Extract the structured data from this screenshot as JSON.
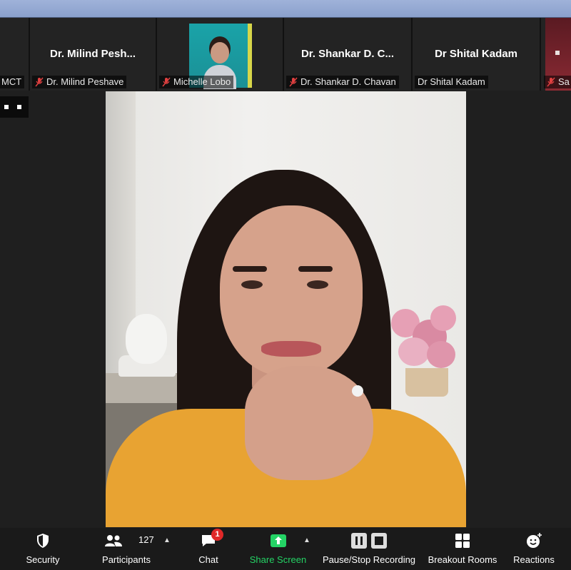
{
  "participants_strip": [
    {
      "display": "",
      "name": "MCT",
      "muted": false
    },
    {
      "display": "Dr. Milind Pesh...",
      "name": "Dr. Milind Peshave",
      "muted": true
    },
    {
      "display": "",
      "name": "Michelle Lobo",
      "muted": true,
      "has_video": true
    },
    {
      "display": "Dr. Shankar D. C...",
      "name": "Dr. Shankar D. Chavan",
      "muted": true
    },
    {
      "display": "Dr Shital Kadam",
      "name": "Dr Shital Kadam",
      "muted": false
    },
    {
      "display": "",
      "name": "Sa",
      "muted": true,
      "has_video": true
    }
  ],
  "toolbar": {
    "security": "Security",
    "participants": "Participants",
    "participants_count": "127",
    "chat": "Chat",
    "chat_badge": "1",
    "share_screen": "Share Screen",
    "recording": "Pause/Stop Recording",
    "breakout": "Breakout Rooms",
    "reactions": "Reactions"
  },
  "colors": {
    "share_screen_green": "#24d365",
    "chat_badge_red": "#e02828",
    "mute_red": "#e04040"
  }
}
